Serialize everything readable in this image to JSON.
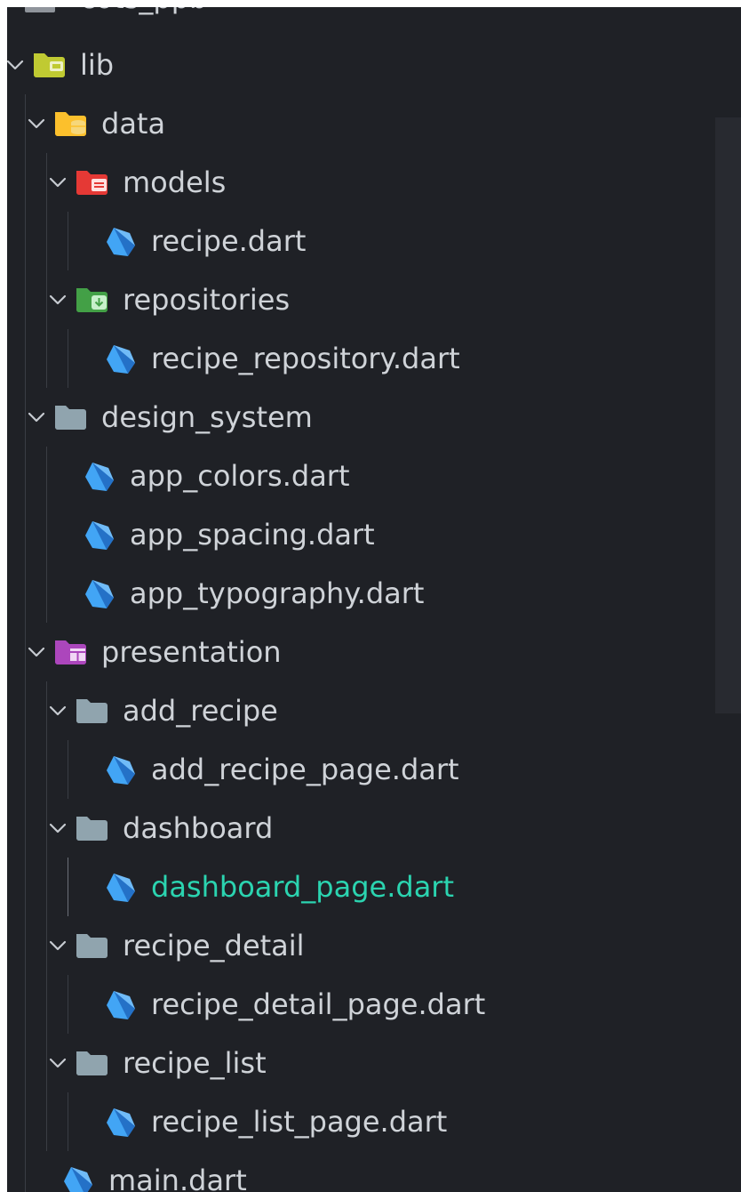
{
  "explorer": {
    "root_folder": "cots_ppb",
    "tree": [
      {
        "label": "lib",
        "type": "folder",
        "icon": "lib-folder-icon",
        "depth": 0,
        "expanded": true
      },
      {
        "label": "data",
        "type": "folder",
        "icon": "database-folder-icon",
        "depth": 1,
        "expanded": true
      },
      {
        "label": "models",
        "type": "folder",
        "icon": "models-folder-icon",
        "depth": 2,
        "expanded": true
      },
      {
        "label": "recipe.dart",
        "type": "file",
        "icon": "dart-file-icon",
        "depth": 3
      },
      {
        "label": "repositories",
        "type": "folder",
        "icon": "repository-folder-icon",
        "depth": 2,
        "expanded": true
      },
      {
        "label": "recipe_repository.dart",
        "type": "file",
        "icon": "dart-file-icon",
        "depth": 3
      },
      {
        "label": "design_system",
        "type": "folder",
        "icon": "folder-icon",
        "depth": 1,
        "expanded": true
      },
      {
        "label": "app_colors.dart",
        "type": "file",
        "icon": "dart-file-icon",
        "depth": 2
      },
      {
        "label": "app_spacing.dart",
        "type": "file",
        "icon": "dart-file-icon",
        "depth": 2
      },
      {
        "label": "app_typography.dart",
        "type": "file",
        "icon": "dart-file-icon",
        "depth": 2
      },
      {
        "label": "presentation",
        "type": "folder",
        "icon": "layout-folder-icon",
        "depth": 1,
        "expanded": true
      },
      {
        "label": "add_recipe",
        "type": "folder",
        "icon": "folder-icon",
        "depth": 2,
        "expanded": true
      },
      {
        "label": "add_recipe_page.dart",
        "type": "file",
        "icon": "dart-file-icon",
        "depth": 3
      },
      {
        "label": "dashboard",
        "type": "folder",
        "icon": "folder-icon",
        "depth": 2,
        "expanded": true
      },
      {
        "label": "dashboard_page.dart",
        "type": "file",
        "icon": "dart-file-icon",
        "depth": 3,
        "active": true
      },
      {
        "label": "recipe_detail",
        "type": "folder",
        "icon": "folder-icon",
        "depth": 2,
        "expanded": true
      },
      {
        "label": "recipe_detail_page.dart",
        "type": "file",
        "icon": "dart-file-icon",
        "depth": 3
      },
      {
        "label": "recipe_list",
        "type": "folder",
        "icon": "folder-icon",
        "depth": 2,
        "expanded": true
      },
      {
        "label": "recipe_list_page.dart",
        "type": "file",
        "icon": "dart-file-icon",
        "depth": 3
      },
      {
        "label": "main.dart",
        "type": "file",
        "icon": "dart-file-icon",
        "depth": 1
      }
    ]
  },
  "colors": {
    "background": "#1f2126",
    "text": "#cfd3d8",
    "active_text": "#2bd4b0",
    "dart_icon": "#42a5f5",
    "lib_folder": "#c0ca33",
    "data_folder": "#fbc02d",
    "models_folder": "#e53935",
    "repositories_folder": "#43a047",
    "plain_folder": "#90a4ae",
    "presentation_folder": "#ab47bc"
  }
}
